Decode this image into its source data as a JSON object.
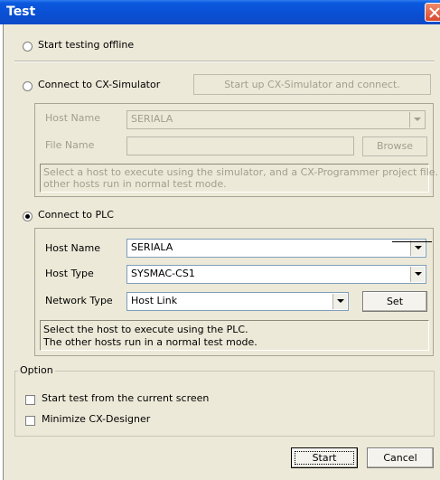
{
  "window": {
    "title": "Test"
  },
  "offline": {
    "label": "Start testing offline"
  },
  "simulator": {
    "label": "Connect to CX-Simulator",
    "start_button": "Start up CX-Simulator and connect.",
    "host_name_label": "Host Name",
    "host_name_value": "SERIALA",
    "file_name_label": "File Name",
    "browse_button": "Browse",
    "note_line1": "Select a host to execute using the simulator, and a CX-Programmer project file. The",
    "note_line2": "other hosts run in normal test mode."
  },
  "plc": {
    "label": "Connect to PLC",
    "selected": true,
    "host_name_label": "Host Name",
    "host_name_value": "SERIALA",
    "host_type_label": "Host Type",
    "host_type_value": "SYSMAC-CS1",
    "network_type_label": "Network Type",
    "network_type_value": "Host Link",
    "set_button": "Set",
    "note_line1": "Select the host to execute using the PLC.",
    "note_line2": "The other hosts run in a normal test mode."
  },
  "option": {
    "group_label": "Option",
    "start_from_current": "Start test from the current screen",
    "minimize": "Minimize CX-Designer"
  },
  "footer": {
    "start_button": "Start",
    "cancel_button": "Cancel"
  },
  "colors": {
    "titlebar": "#0a4fd4",
    "face": "#ece9d8",
    "close": "#d9482c"
  }
}
